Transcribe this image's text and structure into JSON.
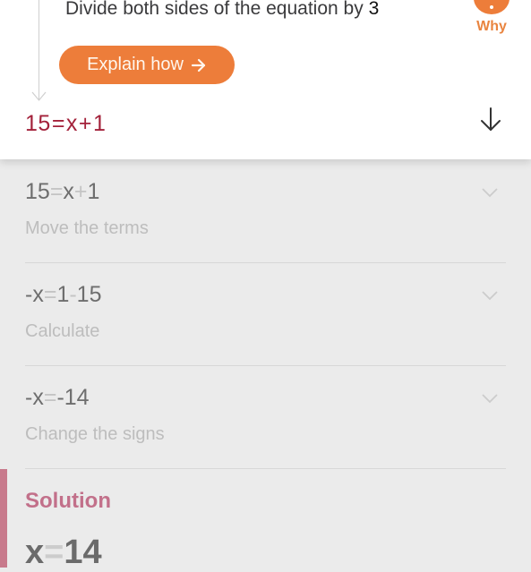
{
  "current_step": {
    "instruction_text": "Divide both sides of the equation by ",
    "instruction_number": "3",
    "why_label": "Why",
    "explain_button_label": "Explain how",
    "explain_button_icon": "arrow-right-icon",
    "equation": {
      "left": "15",
      "eq": "=",
      "var": "x",
      "op": "+",
      "right": "1"
    },
    "expand_icon": "arrow-down-icon"
  },
  "steps": [
    {
      "eq_parts": [
        "15",
        "=",
        "x",
        "+",
        "1"
      ],
      "desc": "Move the terms"
    },
    {
      "eq_parts": [
        "-x",
        "=",
        "1",
        "-",
        "15"
      ],
      "desc": "Calculate"
    },
    {
      "eq_parts": [
        "-x",
        "=",
        "-14",
        "",
        ""
      ],
      "desc": "Change the signs"
    }
  ],
  "solution": {
    "title": "Solution",
    "left": "x",
    "eq": "=",
    "right": "14"
  },
  "colors": {
    "accent_orange": "#ed7d3a",
    "equation_red": "#a3213a",
    "solution_pink": "#c2708a"
  }
}
